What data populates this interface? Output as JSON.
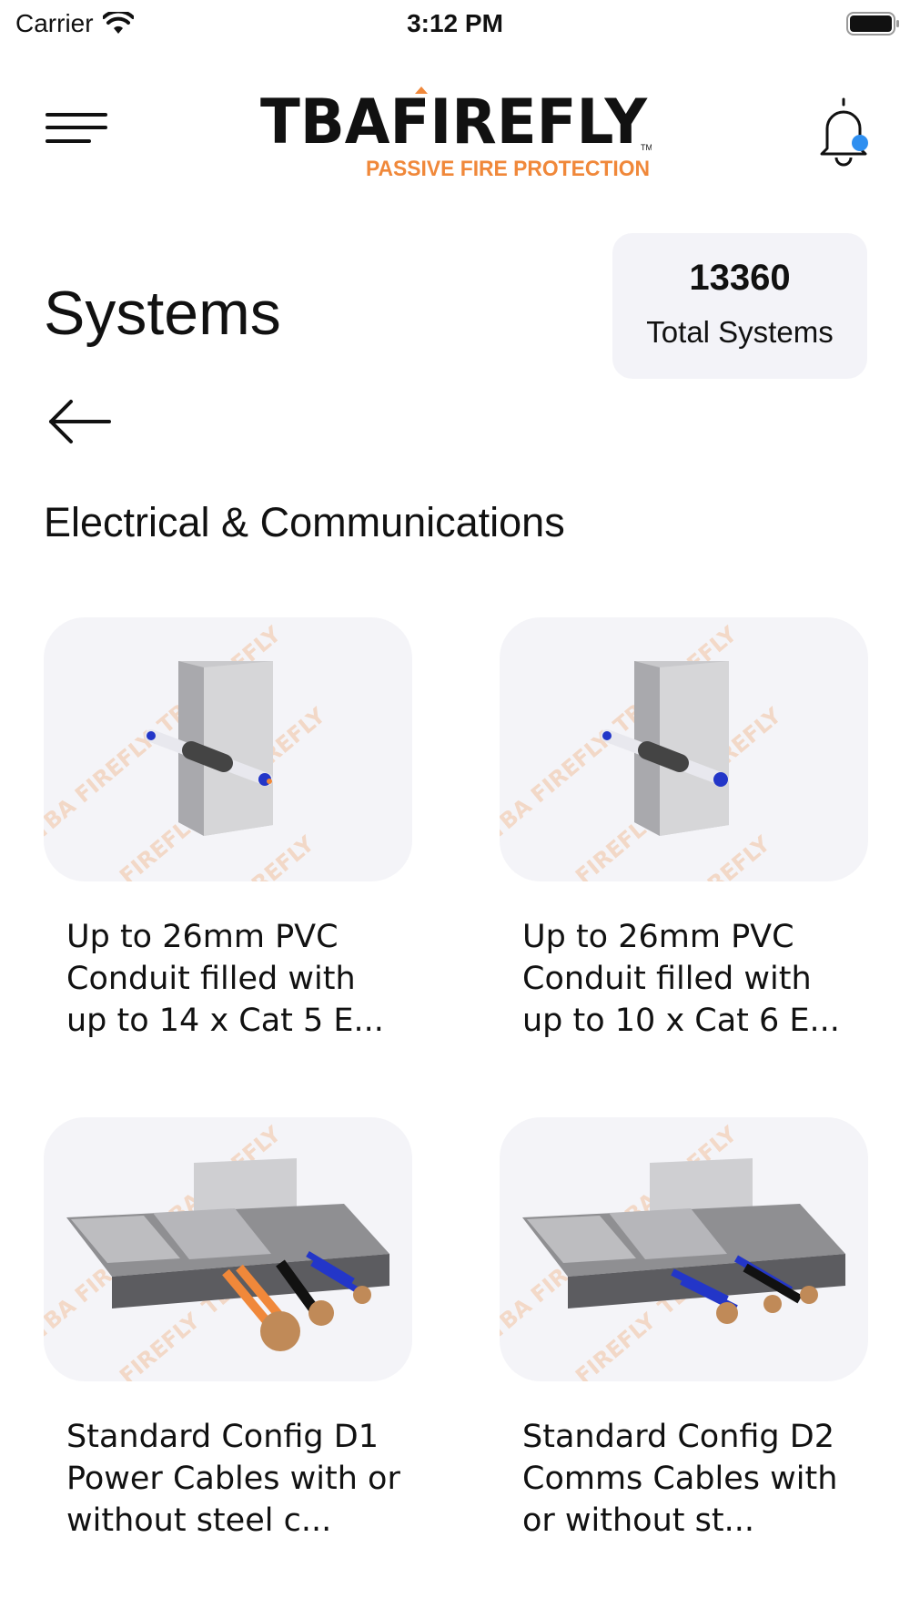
{
  "status_bar": {
    "carrier": "Carrier",
    "time": "3:12 PM"
  },
  "header": {
    "logo_text": "TBAFIREFLY",
    "logo_subtitle": "PASSIVE FIRE PROTECTION",
    "logo_trademark": "TM"
  },
  "page": {
    "title": "Systems",
    "total_count": "13360",
    "total_label": "Total Systems",
    "section_title": "Electrical & Communications"
  },
  "cards": [
    {
      "title": "Up to 26mm PVC Conduit filled with up to 14 x Cat 5 E...",
      "image": "conduit-cat5-render",
      "watermark": "TBA FIREFLY"
    },
    {
      "title": "Up to 26mm PVC Conduit filled with up to 10 x Cat 6 E...",
      "image": "conduit-cat6-render",
      "watermark": "TBA FIREFLY"
    },
    {
      "title": "Standard Config D1 Power Cables with or without steel c...",
      "image": "power-cables-tray-render",
      "watermark": "TBA FIREFLY"
    },
    {
      "title": "Standard Config D2 Comms Cables with or without st...",
      "image": "comms-cables-tray-render",
      "watermark": "TBA FIREFLY"
    }
  ],
  "colors": {
    "brand_orange": "#f0883a",
    "accent_blue": "#2f8ff0",
    "card_bg": "#f4f4f8"
  }
}
